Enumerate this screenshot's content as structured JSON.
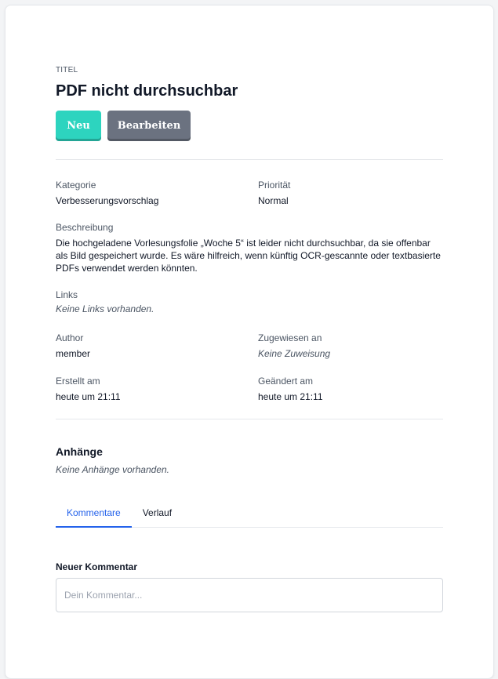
{
  "ticket": {
    "eyebrow": "TITEL",
    "title": "PDF nicht durchsuchbar"
  },
  "actions": {
    "new_label": "Neu",
    "edit_label": "Bearbeiten"
  },
  "colors": {
    "new_button": "#2dd4bf",
    "edit_button": "#6b7280",
    "active_tab": "#2563eb"
  },
  "details": {
    "category_label": "Kategorie",
    "category_value": "Verbesserungsvorschlag",
    "priority_label": "Priorität",
    "priority_value": "Normal",
    "description_label": "Beschreibung",
    "description_value": "Die hochgeladene Vorlesungsfolie „Woche 5“ ist leider nicht durchsuchbar, da sie offenbar als Bild gespeichert wurde. Es wäre hilfreich, wenn künftig OCR-gescannte oder textbasierte PDFs verwendet werden könnten.",
    "links_label": "Links",
    "links_empty": "Keine Links vorhanden.",
    "author_label": "Author",
    "author_value": "member",
    "assigned_label": "Zugewiesen an",
    "assigned_empty": "Keine Zuweisung",
    "created_label": "Erstellt am",
    "created_value": "heute um 21:11",
    "changed_label": "Geändert am",
    "changed_value": "heute um 21:11"
  },
  "attachments": {
    "title": "Anhänge",
    "empty": "Keine Anhänge vorhanden."
  },
  "tabs": [
    {
      "label": "Kommentare",
      "active": true
    },
    {
      "label": "Verlauf",
      "active": false
    }
  ],
  "comment": {
    "label": "Neuer Kommentar",
    "placeholder": "Dein Kommentar..."
  }
}
